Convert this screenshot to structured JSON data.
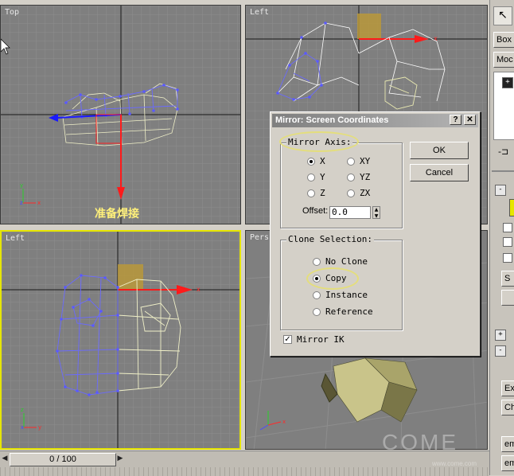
{
  "viewports": {
    "top": {
      "label": "Top",
      "caption": "准备焊接"
    },
    "left_top": {
      "label": "Left"
    },
    "left_bottom": {
      "label": "Left"
    },
    "perspective": {
      "label": "Pers"
    }
  },
  "dialog": {
    "title": "Mirror: Screen Coordinates",
    "help_button": "?",
    "close_button": "✕",
    "mirror_axis": {
      "label": "Mirror Axis:",
      "options": [
        "X",
        "Y",
        "Z",
        "XY",
        "YZ",
        "ZX"
      ],
      "selected": "X",
      "offset_label": "Offset:",
      "offset_value": "0.0"
    },
    "clone_selection": {
      "label": "Clone Selection:",
      "options": [
        "No Clone",
        "Copy",
        "Instance",
        "Reference"
      ],
      "selected": "Copy"
    },
    "mirror_ik": {
      "label": "Mirror IK",
      "checked": true
    },
    "ok_button": "OK",
    "cancel_button": "Cancel"
  },
  "command_panel": {
    "object_type": "Box",
    "modifier": "Moc",
    "buttons": [
      "S",
      "Ex",
      "Ch",
      "emo",
      "emo"
    ]
  },
  "timeline": {
    "frame_display": "0 / 100"
  },
  "watermark": {
    "text": "COME",
    "sub": "www.come.com"
  },
  "colors": {
    "viewport_bg": "#7f7f7f",
    "grid_line": "#8d8d8d",
    "axis": "#1a1a1a",
    "active_border": "#e6e600",
    "highlight_ellipse": "#e4de7c"
  }
}
